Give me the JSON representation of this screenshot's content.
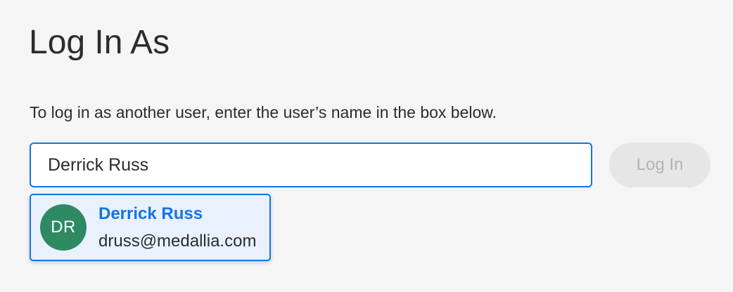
{
  "page": {
    "title": "Log In As",
    "instructions": "To log in as another user, enter the user’s name in the box below."
  },
  "search": {
    "value": "Derrick Russ",
    "placeholder": ""
  },
  "login_button": {
    "label": "Log In",
    "enabled": false
  },
  "suggestions": [
    {
      "initials": "DR",
      "name": "Derrick Russ",
      "email": "druss@medallia.com",
      "avatar_color": "#2d8a63",
      "highlighted": true
    }
  ],
  "colors": {
    "accent": "#1473e6",
    "background": "#f5f5f5",
    "highlight": "#e8f1fc",
    "button_disabled_bg": "#e6e6e6",
    "button_disabled_text": "#b3b3b3"
  }
}
